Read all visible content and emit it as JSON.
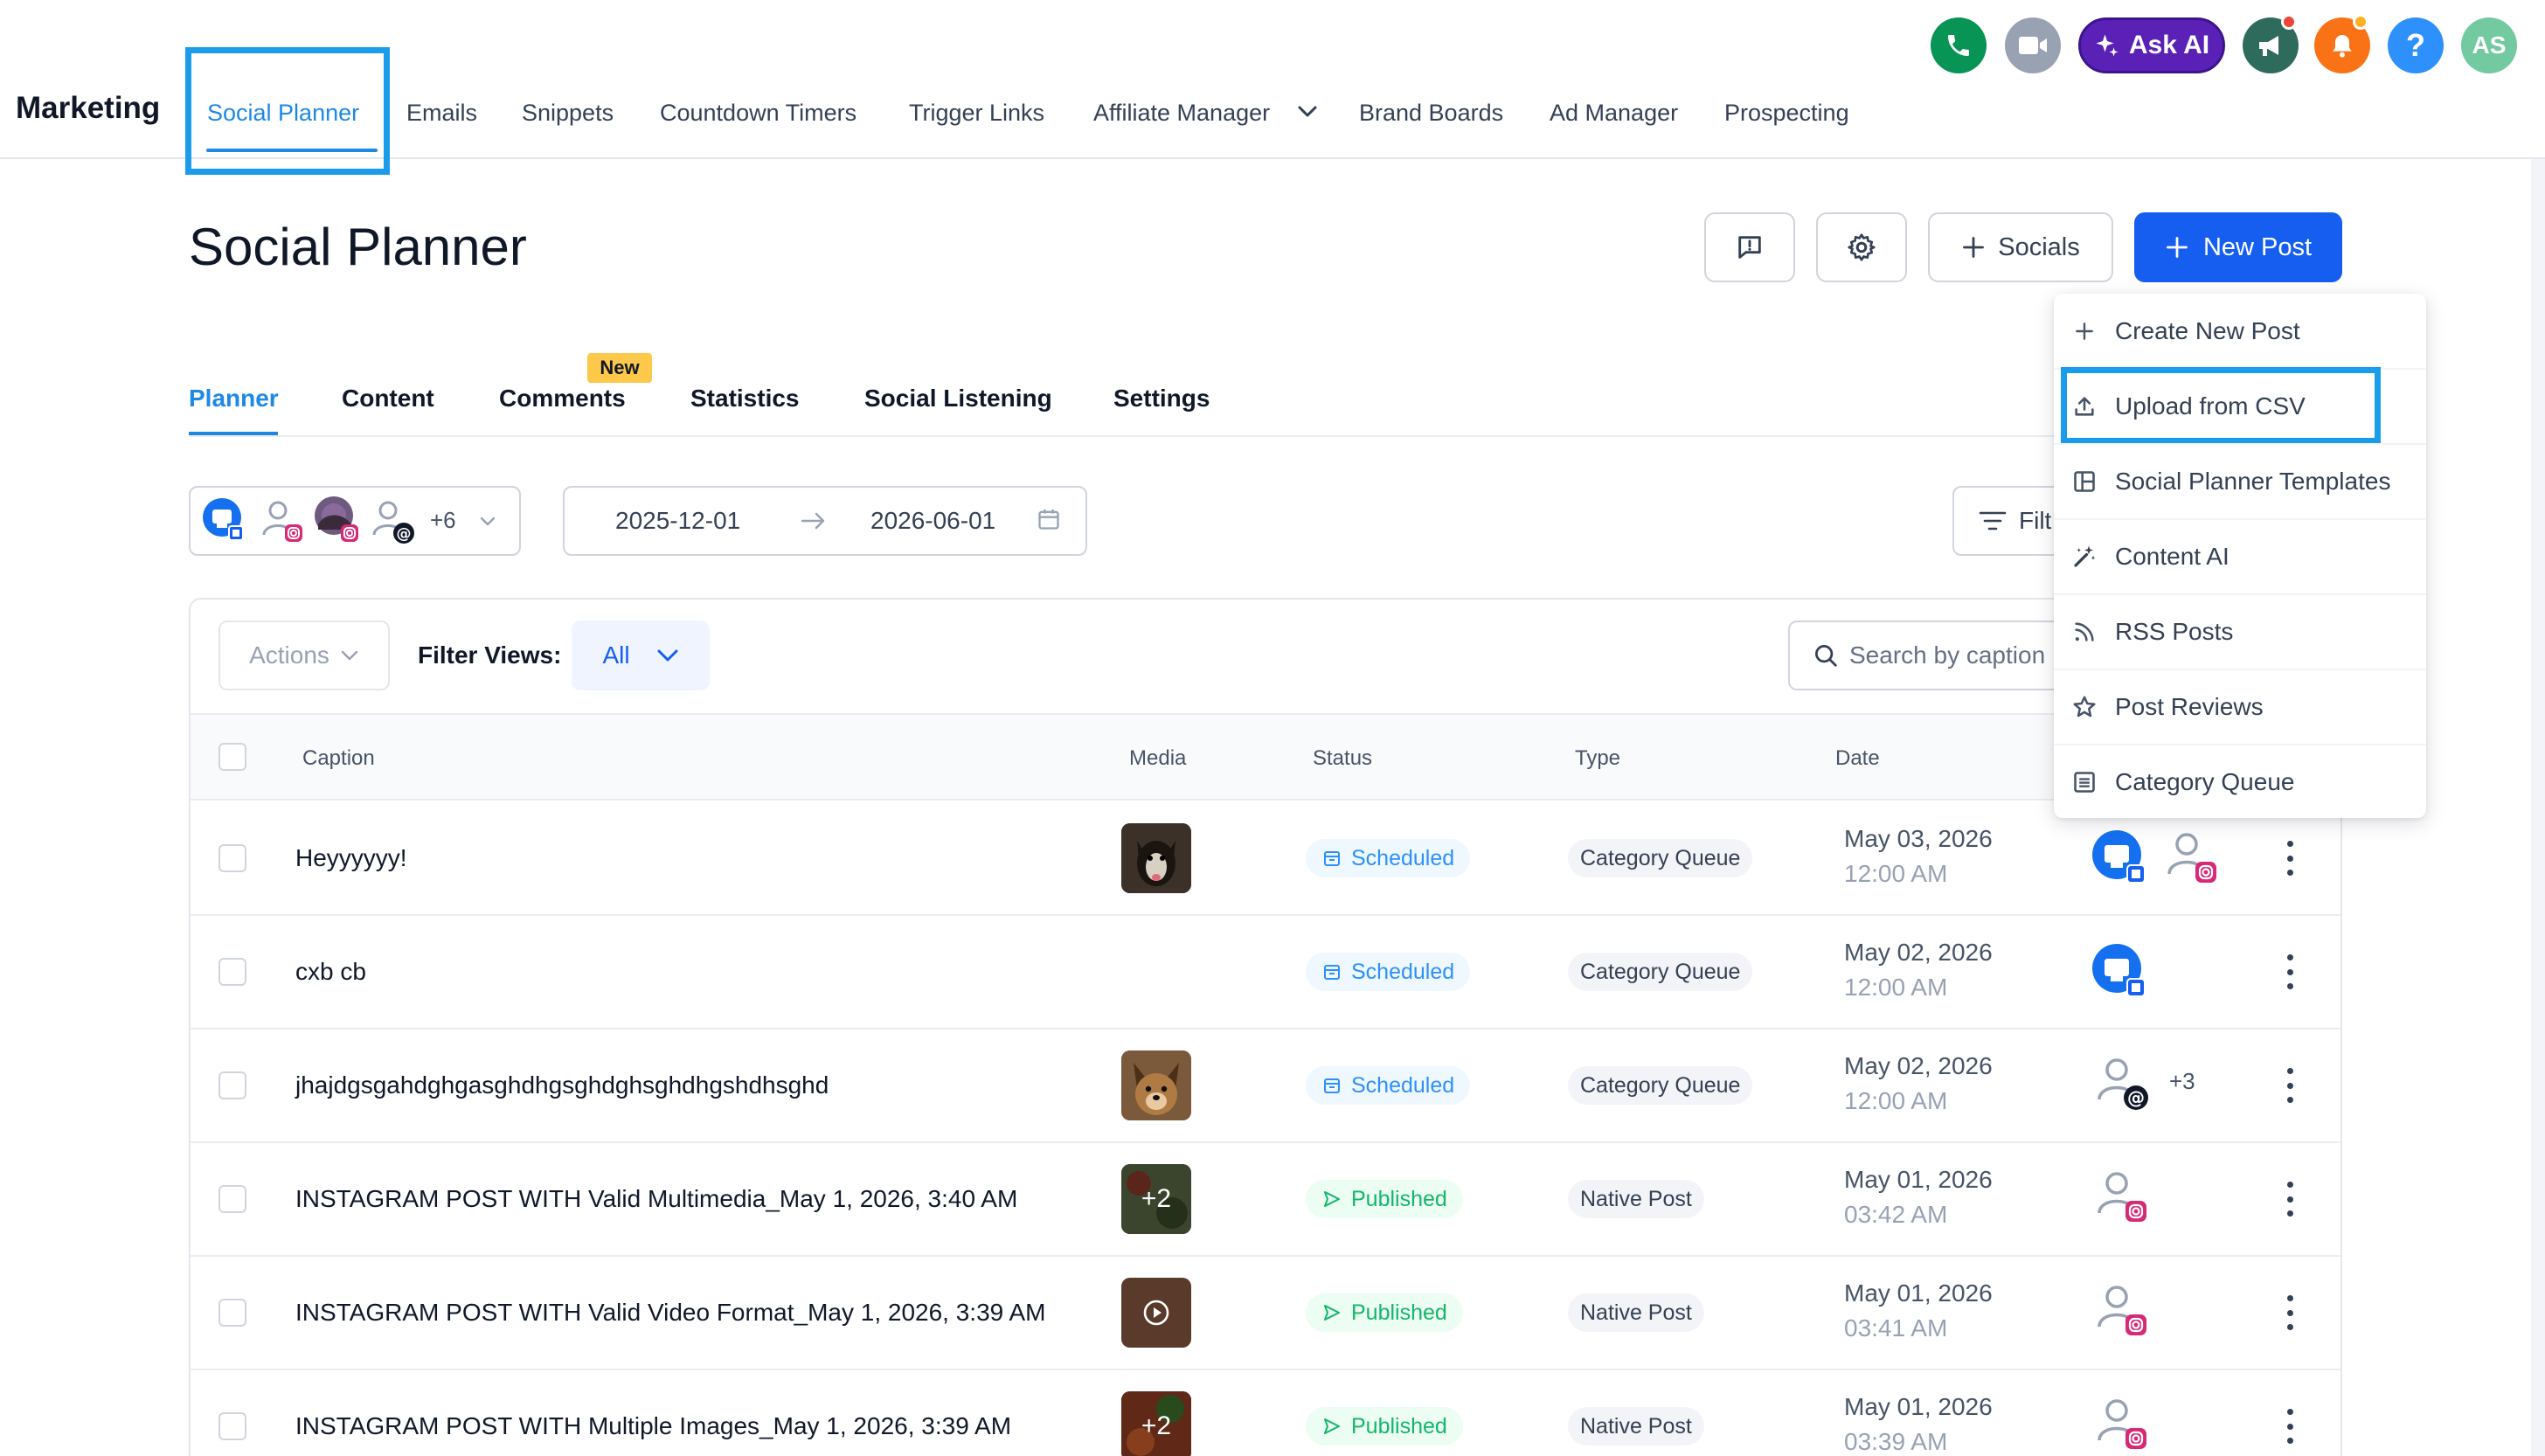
{
  "app": {
    "brand": "Marketing",
    "user_initials": "AS",
    "ask_ai_label": "Ask AI",
    "help_label": "?"
  },
  "nav": {
    "items": [
      {
        "label": "Social Planner",
        "active": true
      },
      {
        "label": "Emails"
      },
      {
        "label": "Snippets"
      },
      {
        "label": "Countdown Timers"
      },
      {
        "label": "Trigger Links"
      },
      {
        "label": "Affiliate Manager"
      },
      {
        "label": "Brand Boards"
      },
      {
        "label": "Ad Manager"
      },
      {
        "label": "Prospecting"
      }
    ]
  },
  "header": {
    "title": "Social Planner",
    "socials_label": "Socials",
    "new_post_label": "New Post"
  },
  "tabs": {
    "items": [
      {
        "label": "Planner",
        "active": true
      },
      {
        "label": "Content"
      },
      {
        "label": "Comments",
        "badge": "New"
      },
      {
        "label": "Statistics"
      },
      {
        "label": "Social Listening"
      },
      {
        "label": "Settings"
      }
    ]
  },
  "filters": {
    "accounts_more": "+6",
    "date_start": "2025-12-01",
    "date_end": "2026-06-01",
    "filter_label": "Filt",
    "actions_label": "Actions",
    "filter_views_label": "Filter Views:",
    "filter_views_value": "All",
    "search_placeholder": "Search by caption"
  },
  "table": {
    "columns": {
      "caption": "Caption",
      "media": "Media",
      "status": "Status",
      "type": "Type",
      "date": "Date"
    },
    "rows": [
      {
        "caption": "Heyyyyyy!",
        "status": "Scheduled",
        "type": "Category Queue",
        "date": "May 03, 2026",
        "time": "12:00 AM",
        "more": ""
      },
      {
        "caption": "cxb cb",
        "status": "Scheduled",
        "type": "Category Queue",
        "date": "May 02, 2026",
        "time": "12:00 AM",
        "more": ""
      },
      {
        "caption": "jhajdgsgahdghgasghdhgsghdghsghdhgshdhsghd",
        "status": "Scheduled",
        "type": "Category Queue",
        "date": "May 02, 2026",
        "time": "12:00 AM",
        "more": "+3"
      },
      {
        "caption": "INSTAGRAM POST WITH Valid Multimedia_May 1, 2026, 3:40 AM",
        "status": "Published",
        "type": "Native Post",
        "date": "May 01, 2026",
        "time": "03:42 AM",
        "media_count": "+2"
      },
      {
        "caption": "INSTAGRAM POST WITH Valid Video Format_May 1, 2026, 3:39 AM",
        "status": "Published",
        "type": "Native Post",
        "date": "May 01, 2026",
        "time": "03:41 AM"
      },
      {
        "caption": "INSTAGRAM POST WITH Multiple Images_May 1, 2026, 3:39 AM",
        "status": "Published",
        "type": "Native Post",
        "date": "May 01, 2026",
        "time": "03:39 AM",
        "media_count": "+2"
      }
    ]
  },
  "dropdown": {
    "items": [
      {
        "label": "Create New Post",
        "icon": "plus-icon"
      },
      {
        "label": "Upload from CSV",
        "icon": "upload-icon"
      },
      {
        "label": "Social Planner Templates",
        "icon": "template-icon"
      },
      {
        "label": "Content AI",
        "icon": "magic-wand-icon"
      },
      {
        "label": "RSS Posts",
        "icon": "rss-icon"
      },
      {
        "label": "Post Reviews",
        "icon": "star-icon"
      },
      {
        "label": "Category Queue",
        "icon": "list-icon"
      }
    ]
  },
  "colors": {
    "accent": "#155eef",
    "active_tab": "#1e88e5",
    "annotation": "#1a9cea",
    "ask_ai": "#5b21b6",
    "scheduled": "#2e90fa",
    "published": "#12b76a"
  }
}
